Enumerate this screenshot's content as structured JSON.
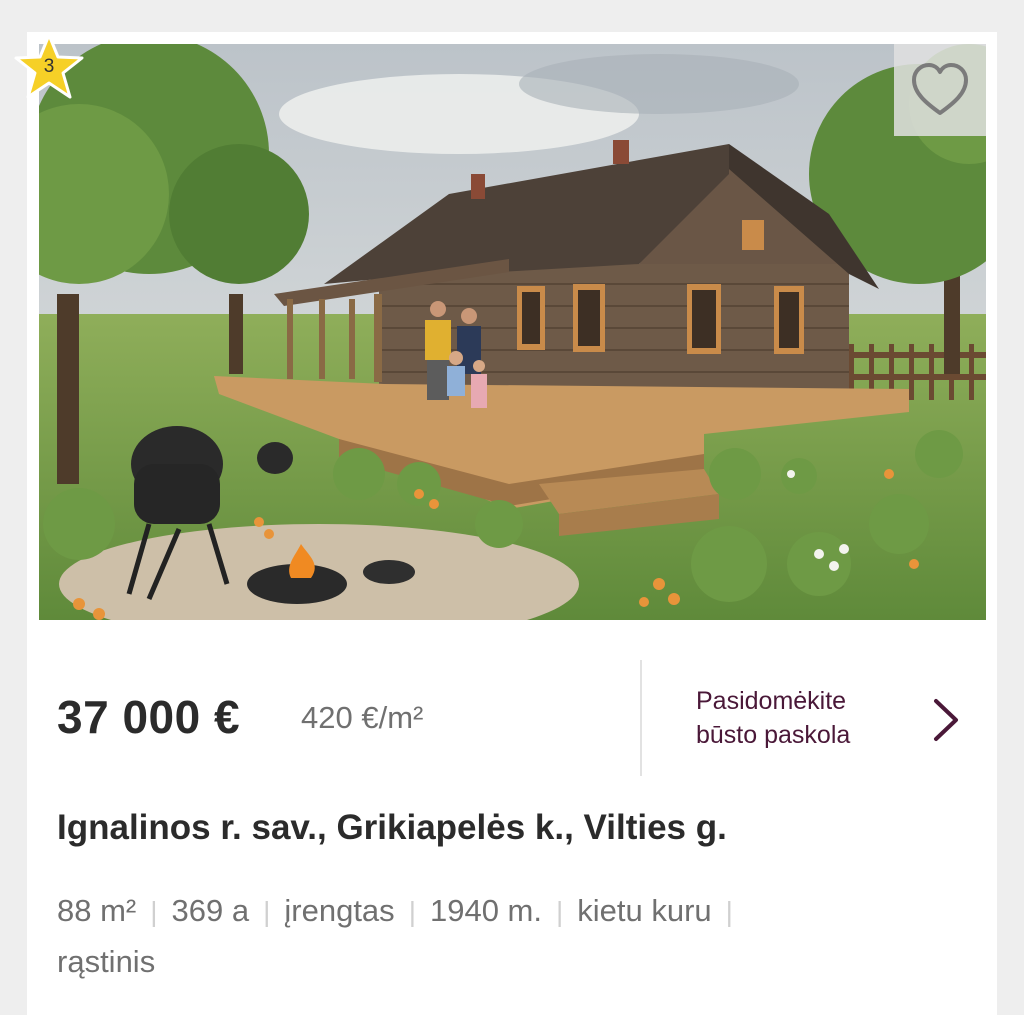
{
  "listing": {
    "badge_number": "3",
    "price": "37 000 €",
    "price_per_m2": "420 €/m²",
    "loan_link": {
      "line1": "Pasidomėkite",
      "line2": "būsto paskola"
    },
    "address": "Ignalinos r. sav., Grikiapelės k., Vilties g.",
    "features": [
      "88 m²",
      "369 a",
      "įrengtas",
      "1940 m.",
      "kietu kuru",
      "rąstinis"
    ]
  },
  "colors": {
    "accent": "#4a1838",
    "badge": "#f6d027",
    "price_text": "#2b2b2b",
    "muted_text": "#707070"
  },
  "icons": {
    "favorite": "heart-outline-icon",
    "badge": "star-icon",
    "loan": "chevron-right-icon"
  }
}
